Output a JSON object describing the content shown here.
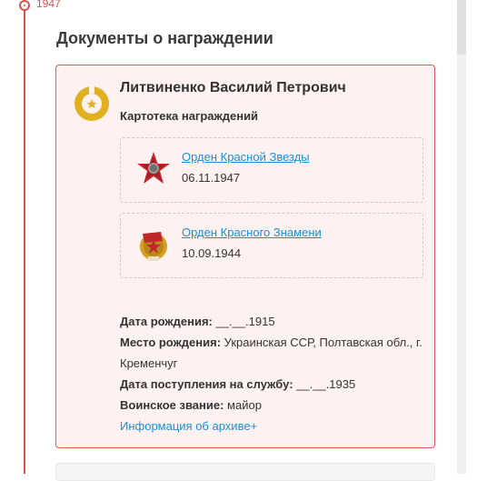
{
  "timeline": {
    "year": "1947"
  },
  "section": {
    "title": "Документы о награждении"
  },
  "person": {
    "name": "Литвиненко Василий Петрович",
    "subtitle": "Картотека награждений"
  },
  "awards": [
    {
      "name": "Орден Красной Звезды",
      "date": "06.11.1947",
      "icon": "red-star-order-icon"
    },
    {
      "name": "Орден Красного Знамени",
      "date": "10.09.1944",
      "icon": "red-banner-order-icon"
    }
  ],
  "details": {
    "birth_date_label": "Дата рождения:",
    "birth_date_value": " __.__.1915",
    "birth_place_label": "Место рождения:",
    "birth_place_value": " Украинская ССР, Полтавская обл., г. Кременчуг",
    "service_date_label": "Дата поступления на службу:",
    "service_date_value": " __.__.1935",
    "rank_label": "Воинское звание:",
    "rank_value": " майор",
    "archive_link": "Информация об архиве+"
  },
  "colors": {
    "accent": "#d9534f",
    "link": "#1a8fd8",
    "card_bg": "#fdf1f1",
    "badge": "#e0b020"
  }
}
